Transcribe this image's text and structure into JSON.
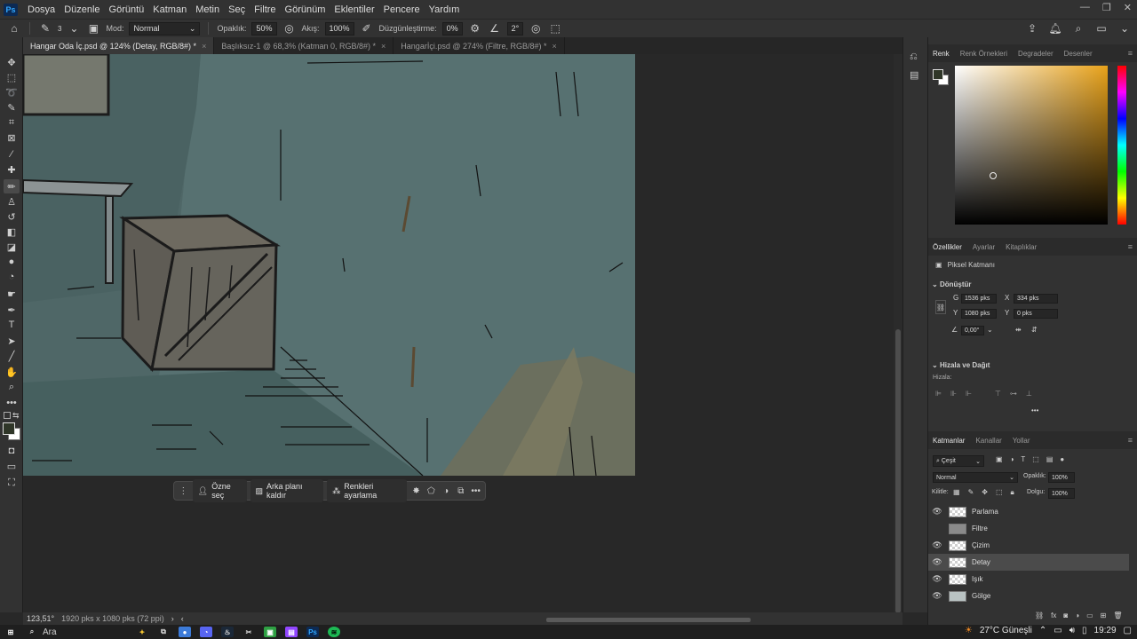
{
  "menubar": {
    "app_icon": "Ps",
    "items": [
      "Dosya",
      "Düzenle",
      "Görüntü",
      "Katman",
      "Metin",
      "Seç",
      "Filtre",
      "Görünüm",
      "Eklentiler",
      "Pencere",
      "Yardım"
    ]
  },
  "options": {
    "brush_size": "3",
    "mode_label": "Mod:",
    "mode_value": "Normal",
    "opacity_label": "Opaklık:",
    "opacity_value": "50%",
    "flow_label": "Akış:",
    "flow_value": "100%",
    "smoothing_label": "Düzgünleştirme:",
    "smoothing_value": "0%",
    "angle_value": "2°"
  },
  "tabs": [
    {
      "label": "Hangar Oda İç.psd @ 124% (Detay, RGB/8#) *"
    },
    {
      "label": "Başlıksız-1 @ 68,3% (Katman 0, RGB/8#) *"
    },
    {
      "label": "Hangarİçi.psd @ 274% (Filtre, RGB/8#) *"
    }
  ],
  "context_bar": {
    "select_subject": "Özne seç",
    "remove_bg": "Arka planı kaldır",
    "color_adjust": "Renkleri ayarlama"
  },
  "status": {
    "zoom": "123,51°",
    "doc_size": "1920 pks x 1080 pks (72 ppi)"
  },
  "color_panel": {
    "tabs": [
      "Renk",
      "Renk Örnekleri",
      "Degradeler",
      "Desenler"
    ],
    "accent": "#e8a21a"
  },
  "properties": {
    "tabs": [
      "Özellikler",
      "Ayarlar",
      "Kitaplıklar"
    ],
    "layer_type": "Piksel Katmanı",
    "transform_title": "Dönüştür",
    "w_label": "G",
    "w_value": "1536 pks",
    "x_label": "X",
    "x_value": "334 pks",
    "h_label": "Y",
    "h_value": "1080 pks",
    "y_label": "Y",
    "y_value": "0 pks",
    "angle_value": "0,00°",
    "align_title": "Hizala ve Dağıt",
    "align_sub": "Hizala:",
    "more": "•••"
  },
  "layers_panel": {
    "tabs": [
      "Katmanlar",
      "Kanallar",
      "Yollar"
    ],
    "filter_label": "Çeşit",
    "blend_mode": "Normal",
    "opacity_label": "Opaklık:",
    "opacity_value": "100%",
    "lock_label": "Kilitle:",
    "fill_label": "Dolgu:",
    "fill_value": "100%",
    "layers": [
      {
        "name": "Parlama",
        "visible": true
      },
      {
        "name": "Filtre",
        "visible": false
      },
      {
        "name": "Çizim",
        "visible": true
      },
      {
        "name": "Detay",
        "visible": true,
        "selected": true
      },
      {
        "name": "Işık",
        "visible": true
      },
      {
        "name": "Gölge",
        "visible": true
      }
    ]
  },
  "taskbar": {
    "search": "Ara",
    "weather": "27°C Güneşli",
    "time": "19:29"
  }
}
